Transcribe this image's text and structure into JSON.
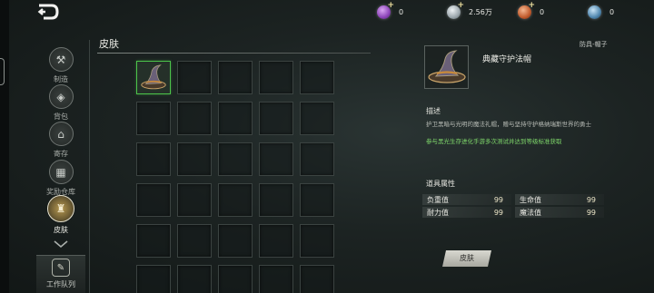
{
  "currencies": [
    {
      "icon": "purple-gem-icon",
      "value": "0",
      "color": "#9b5cc8"
    },
    {
      "icon": "silver-coin-icon",
      "value": "2.56万",
      "color": "#a9b3b8"
    },
    {
      "icon": "copper-coin-icon",
      "value": "0",
      "color": "#c96a3a"
    },
    {
      "icon": "blue-crystal-icon",
      "value": "0",
      "color": "#5b8fb5"
    }
  ],
  "sidebar": {
    "items": [
      {
        "label": "制造",
        "icon": "anvil-icon"
      },
      {
        "label": "背包",
        "icon": "bag-icon"
      },
      {
        "label": "寄存",
        "icon": "house-icon"
      },
      {
        "label": "奖励仓库",
        "icon": "chest-icon"
      },
      {
        "label": "皮肤",
        "icon": "armor-icon",
        "active": true
      }
    ],
    "work_queue": "工作队列"
  },
  "panel": {
    "title": "皮肤",
    "grid_rows": 6,
    "grid_cols": 5,
    "selected_slot": 0
  },
  "detail": {
    "category": "防具-帽子",
    "name": "典藏守护法帽",
    "desc_title": "描述",
    "desc": "护卫黑暗与光明的魔法礼帽，赠与坚持守护格纳瑞斯世界的勇士",
    "source": "参与黑光生存进化手游多次测试并达到等级标准获取",
    "attr_title": "道具属性",
    "attributes": [
      {
        "name": "负重值",
        "value": "99"
      },
      {
        "name": "生命值",
        "value": "99"
      },
      {
        "name": "耐力值",
        "value": "99"
      },
      {
        "name": "魔法值",
        "value": "99"
      }
    ],
    "button": "皮肤"
  },
  "colors": {
    "selected_border": "#4cc44a",
    "source_text": "#7ed66a"
  }
}
